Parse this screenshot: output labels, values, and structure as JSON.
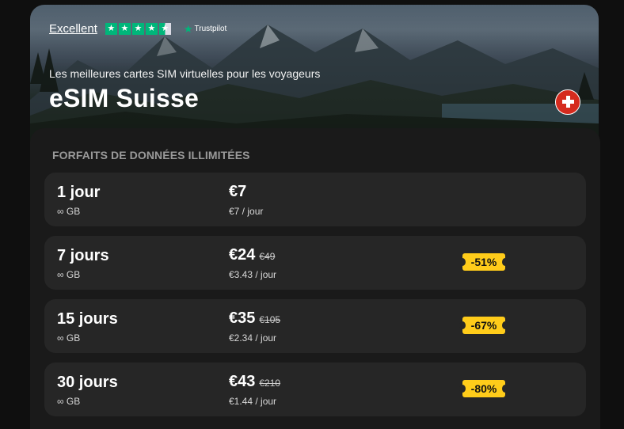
{
  "hero": {
    "rating_label": "Excellent",
    "trustpilot_label": "Trustpilot",
    "star_icon": "star-icon",
    "subtitle": "Les meilleures cartes SIM virtuelles pour les voyageurs",
    "title": "eSIM Suisse",
    "flag_icon": "swiss-flag-icon"
  },
  "plans_section": {
    "label": "FORFAITS DE DONNÉES ILLIMITÉES",
    "plans": [
      {
        "duration": "1 jour",
        "data": "∞ GB",
        "price": "€7",
        "old_price": "",
        "per_day": "€7 / jour",
        "discount": ""
      },
      {
        "duration": "7 jours",
        "data": "∞ GB",
        "price": "€24",
        "old_price": "€49",
        "per_day": "€3.43 / jour",
        "discount": "-51%"
      },
      {
        "duration": "15 jours",
        "data": "∞ GB",
        "price": "€35",
        "old_price": "€105",
        "per_day": "€2.34 / jour",
        "discount": "-67%"
      },
      {
        "duration": "30 jours",
        "data": "∞ GB",
        "price": "€43",
        "old_price": "€210",
        "per_day": "€1.44 / jour",
        "discount": "-80%"
      }
    ]
  },
  "colors": {
    "accent_badge": "#ffcc1a",
    "trustpilot_green": "#00b67a",
    "flag_red": "#d52b1e"
  }
}
